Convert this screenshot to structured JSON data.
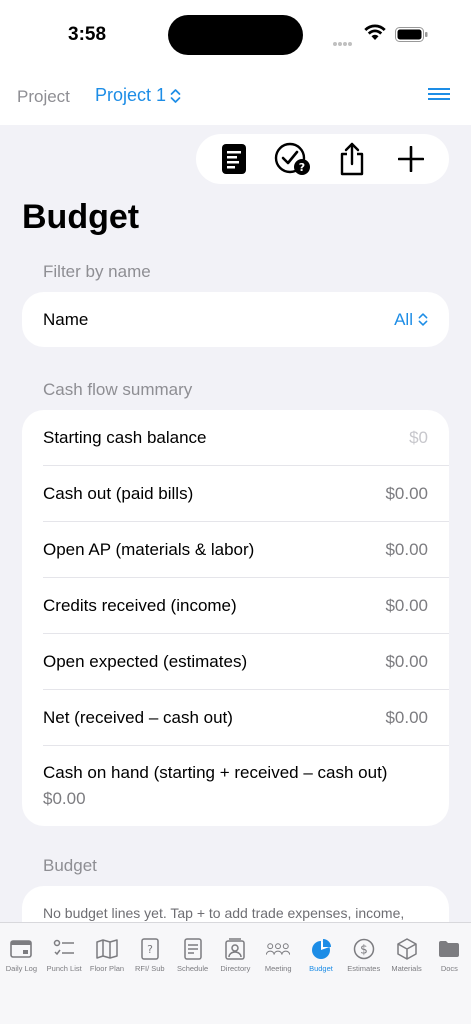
{
  "status": {
    "time": "3:58"
  },
  "nav": {
    "label": "Project",
    "project": "Project 1"
  },
  "page": {
    "title": "Budget"
  },
  "filter": {
    "header": "Filter by name",
    "name_label": "Name",
    "name_value": "All"
  },
  "cashflow": {
    "header": "Cash flow summary",
    "rows": [
      {
        "label": "Starting cash balance",
        "value": "$0"
      },
      {
        "label": "Cash out (paid bills)",
        "value": "$0.00"
      },
      {
        "label": "Open AP (materials & labor)",
        "value": "$0.00"
      },
      {
        "label": "Credits received (income)",
        "value": "$0.00"
      },
      {
        "label": "Open expected (estimates)",
        "value": "$0.00"
      },
      {
        "label": "Net (received – cash out)",
        "value": "$0.00"
      },
      {
        "label": "Cash on hand (starting + received – cash out)",
        "value": "$0.00"
      }
    ]
  },
  "budget": {
    "header": "Budget",
    "empty_message": "No budget lines yet. Tap + to add trade expenses, income,"
  },
  "tabs": [
    {
      "label": "Daily Log",
      "icon": "daily-log-icon"
    },
    {
      "label": "Punch List",
      "icon": "punch-list-icon"
    },
    {
      "label": "Floor Plan",
      "icon": "floor-plan-icon"
    },
    {
      "label": "RFI/ Sub",
      "icon": "rfi-icon"
    },
    {
      "label": "Schedule",
      "icon": "schedule-icon"
    },
    {
      "label": "Directory",
      "icon": "directory-icon"
    },
    {
      "label": "Meeting",
      "icon": "meeting-icon"
    },
    {
      "label": "Budget",
      "icon": "budget-pie-icon"
    },
    {
      "label": "Estimates",
      "icon": "estimates-icon"
    },
    {
      "label": "Materials",
      "icon": "materials-icon"
    },
    {
      "label": "Docs",
      "icon": "docs-folder-icon"
    }
  ],
  "colors": {
    "accent": "#1d8de6",
    "background": "#f2f2f7",
    "secondary_text": "#8e8e93"
  }
}
